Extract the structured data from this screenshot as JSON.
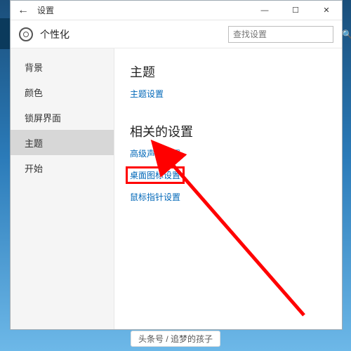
{
  "titlebar": {
    "title": "设置"
  },
  "header": {
    "title": "个性化"
  },
  "search": {
    "placeholder": "查找设置"
  },
  "sidebar": {
    "items": [
      {
        "label": "背景"
      },
      {
        "label": "颜色"
      },
      {
        "label": "锁屏界面"
      },
      {
        "label": "主题"
      },
      {
        "label": "开始"
      }
    ],
    "selected_index": 3
  },
  "content": {
    "section1": {
      "heading": "主题",
      "link1": "主题设置"
    },
    "section2": {
      "heading": "相关的设置",
      "link1": "高级声音设置",
      "link2": "桌面图标设置",
      "link3": "鼠标指针设置"
    }
  },
  "annotation": {
    "highlight_target": "桌面图标设置"
  },
  "watermark": {
    "text": "头条号 / 追梦的孩子"
  }
}
